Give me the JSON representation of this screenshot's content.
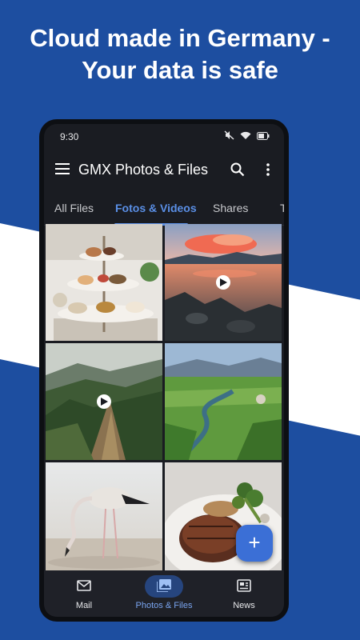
{
  "promo": {
    "headline_line1": "Cloud made in Germany -",
    "headline_line2": "Your data is safe"
  },
  "status_bar": {
    "time": "9:30",
    "icons": [
      "mute-icon",
      "wifi-icon",
      "battery-icon"
    ]
  },
  "app_bar": {
    "title": "GMX Photos & Files",
    "icons": [
      "menu-icon",
      "search-icon",
      "more-icon"
    ]
  },
  "tabs": [
    {
      "label": "All Files",
      "active": false
    },
    {
      "label": "Fotos & Videos",
      "active": true
    },
    {
      "label": "Shares",
      "active": false
    },
    {
      "label": "T",
      "active": false
    }
  ],
  "media": [
    {
      "subject": "dessert-stand",
      "video": false
    },
    {
      "subject": "lake-sunset",
      "video": true
    },
    {
      "subject": "mountain-ridge",
      "video": true
    },
    {
      "subject": "river-valley",
      "video": false
    },
    {
      "subject": "flamingo",
      "video": false
    },
    {
      "subject": "steak-dish",
      "video": false
    }
  ],
  "fab": {
    "label": "+"
  },
  "bottom_nav": [
    {
      "label": "Mail",
      "icon": "mail-icon",
      "active": false
    },
    {
      "label": "Photos & Files",
      "icon": "photos-icon",
      "active": true
    },
    {
      "label": "News",
      "icon": "news-icon",
      "active": false
    }
  ],
  "colors": {
    "brand_blue": "#1d4ea0",
    "accent": "#5a8fe6",
    "fab": "#3b6fd6",
    "screen_bg": "#1a1c22"
  }
}
